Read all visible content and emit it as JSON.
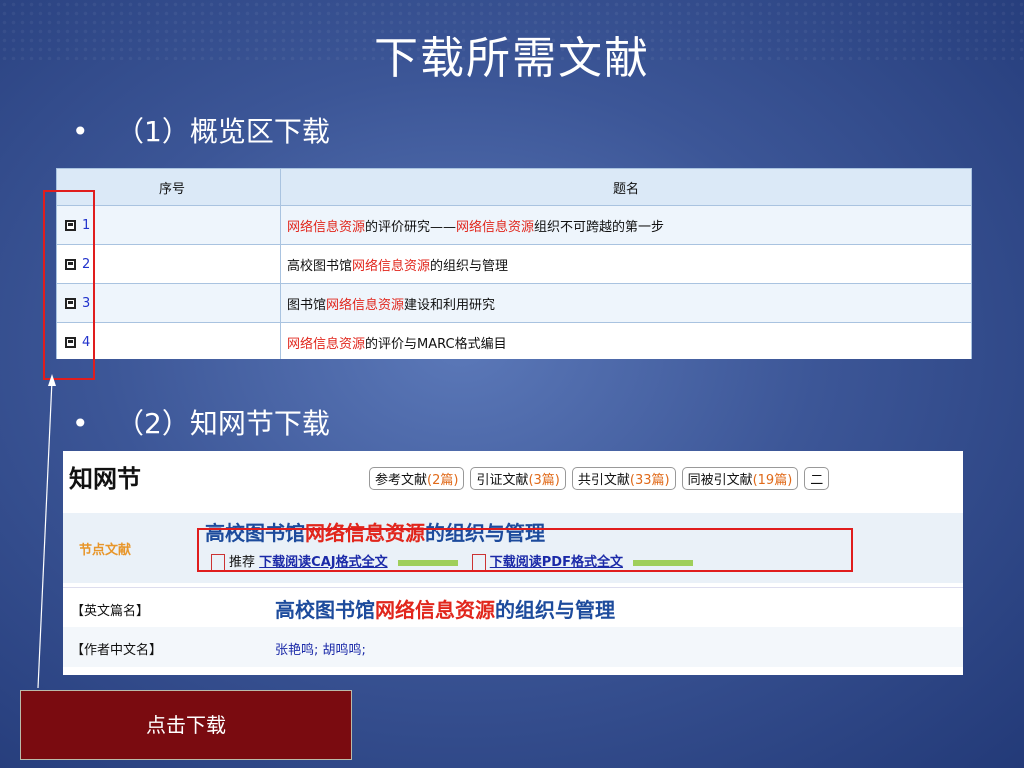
{
  "title": "下载所需文献",
  "bullets": [
    "（1）概览区下载",
    "（2）知网节下载"
  ],
  "table": {
    "headers": [
      "序号",
      "题名"
    ],
    "rows": [
      {
        "num": "1",
        "title_parts": [
          "网络信息资源",
          "的评价研究——",
          "网络信息资源",
          "组织不可跨越的第一步"
        ]
      },
      {
        "num": "2",
        "title_parts": [
          "高校图书馆",
          "网络信息资源",
          "的组织与管理"
        ]
      },
      {
        "num": "3",
        "title_parts": [
          "图书馆",
          "网络信息资源",
          "建设和利用研究"
        ]
      },
      {
        "num": "4",
        "title_parts": [
          "网络信息资源",
          "的评价与MARC格式编目"
        ]
      }
    ]
  },
  "cnki": {
    "logo": "知网节",
    "tabs": [
      {
        "label": "参考文献",
        "count": "(2篇)"
      },
      {
        "label": "引证文献",
        "count": "(3篇)"
      },
      {
        "label": "共引文献",
        "count": "(33篇)"
      },
      {
        "label": "同被引文献",
        "count": "(19篇)"
      },
      {
        "label": "二",
        "count": ""
      }
    ],
    "badge": "节点文献",
    "article_title_parts": [
      "高校图书馆",
      "网络信息资源",
      "的组织与管理"
    ],
    "recommend": "推荐",
    "caj_link": "下载阅读CAJ格式全文",
    "pdf_link": "下载阅读PDF格式全文",
    "en_label": "【英文篇名】",
    "en_value_parts": [
      "高校图书馆",
      "网络信息资源",
      "的组织与管理"
    ],
    "author_label": "【作者中文名】",
    "authors": "张艳鸣; 胡鸣鸣;"
  },
  "button": "点击下载",
  "colors": {
    "accent_red": "#e01d1d",
    "button_bg": "#7a0b10",
    "highlight": "#e1261c",
    "link": "#1b2aa8"
  }
}
